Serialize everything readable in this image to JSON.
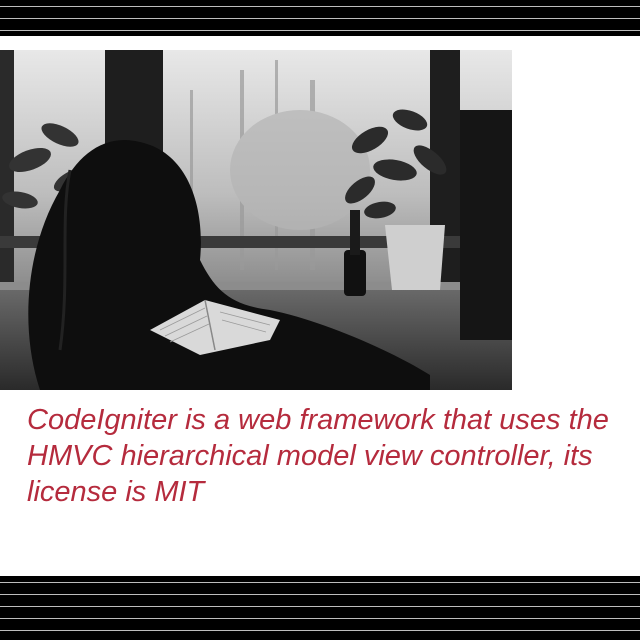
{
  "caption": {
    "text": "CodeIgniter is a web framework that uses the HMVC hierarchical model view controller, its license is MIT",
    "color": "#b52b3d"
  },
  "photo": {
    "style": "black-and-white"
  }
}
